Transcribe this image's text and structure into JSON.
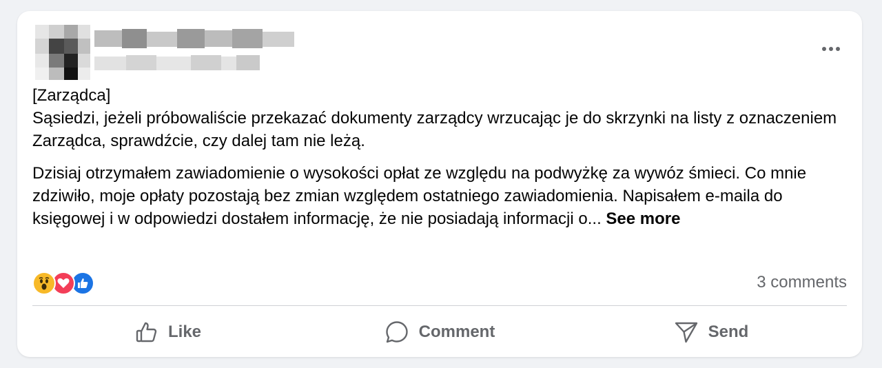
{
  "post": {
    "header": {
      "more_icon": "more-horizontal-icon"
    },
    "body": {
      "tag": "[Zarządca]",
      "paragraph1": "Sąsiedzi, jeżeli próbowaliście przekazać dokumenty zarządcy wrzucając je do skrzynki na listy z oznaczeniem Zarządca, sprawdźcie, czy dalej tam nie leżą.",
      "paragraph2": "Dzisiaj otrzymałem zawiadomienie o wysokości opłat ze względu na podwyżkę za wywóz śmieci. Co mnie zdziwiło, moje opłaty pozostają bez zmian względem ostatniego zawiadomienia. Napisałem e-maila do księgowej i w odpowiedzi dostałem informację, że nie posiadają informacji o...",
      "see_more": "See more"
    },
    "reactions": {
      "icons": [
        "wow-reaction-icon",
        "love-reaction-icon",
        "like-reaction-icon"
      ],
      "comments_label": "3 comments"
    },
    "actions": {
      "like_label": "Like",
      "comment_label": "Comment",
      "send_label": "Send"
    }
  },
  "colors": {
    "background": "#f0f2f5",
    "card": "#ffffff",
    "text_primary": "#050505",
    "text_secondary": "#65676b",
    "wow": "#f7b928",
    "love": "#f33e58",
    "like": "#1b74e4"
  }
}
